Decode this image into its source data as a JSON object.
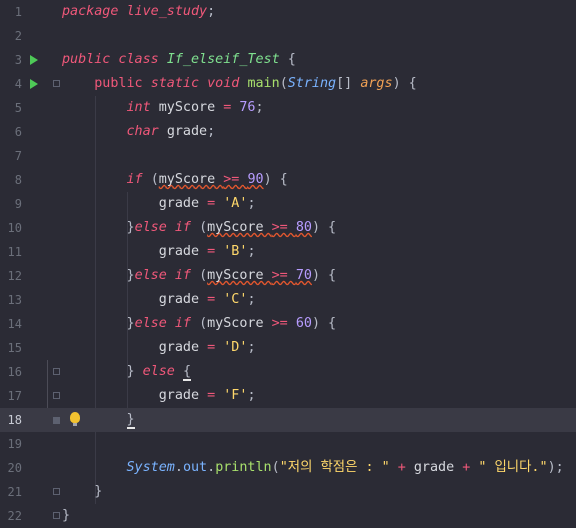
{
  "editor": {
    "current_line": 18,
    "lines": [
      {
        "n": "1",
        "tokens": [
          [
            "kw",
            "package"
          ],
          [
            "var",
            " "
          ],
          [
            "kw",
            "live_study"
          ],
          [
            "punct",
            ";"
          ]
        ]
      },
      {
        "n": "2",
        "tokens": []
      },
      {
        "n": "3",
        "tokens": [
          [
            "kw",
            "public class "
          ],
          [
            "cls",
            "If_elseif_Test"
          ],
          [
            "punct",
            " {"
          ]
        ]
      },
      {
        "n": "4",
        "tokens": [
          [
            "var",
            "    "
          ],
          [
            "kwp",
            "public "
          ],
          [
            "kw",
            "static void "
          ],
          [
            "fn",
            "main"
          ],
          [
            "punct",
            "("
          ],
          [
            "type",
            "String"
          ],
          [
            "punct",
            "[] "
          ],
          [
            "param",
            "args"
          ],
          [
            "punct",
            ") {"
          ]
        ]
      },
      {
        "n": "5",
        "tokens": [
          [
            "var",
            "        "
          ],
          [
            "kw",
            "int "
          ],
          [
            "var",
            "myScore "
          ],
          [
            "op",
            "= "
          ],
          [
            "num",
            "76"
          ],
          [
            "punct",
            ";"
          ]
        ]
      },
      {
        "n": "6",
        "tokens": [
          [
            "var",
            "        "
          ],
          [
            "kw",
            "char "
          ],
          [
            "var",
            "grade"
          ],
          [
            "punct",
            ";"
          ]
        ]
      },
      {
        "n": "7",
        "tokens": []
      },
      {
        "n": "8",
        "tokens": [
          [
            "var",
            "        "
          ],
          [
            "kw",
            "if "
          ],
          [
            "punct",
            "("
          ],
          [
            "var wavy",
            "myScore "
          ],
          [
            "op wavy",
            ">= "
          ],
          [
            "num wavy",
            "90"
          ],
          [
            "punct",
            ") {"
          ]
        ]
      },
      {
        "n": "9",
        "tokens": [
          [
            "var",
            "            grade "
          ],
          [
            "op",
            "= "
          ],
          [
            "str",
            "'A'"
          ],
          [
            "punct",
            ";"
          ]
        ]
      },
      {
        "n": "10",
        "tokens": [
          [
            "var",
            "        "
          ],
          [
            "punct",
            "}"
          ],
          [
            "kw",
            "else if "
          ],
          [
            "punct",
            "("
          ],
          [
            "var wavy",
            "myScore "
          ],
          [
            "op wavy",
            ">= "
          ],
          [
            "num wavy",
            "80"
          ],
          [
            "punct",
            ") {"
          ]
        ]
      },
      {
        "n": "11",
        "tokens": [
          [
            "var",
            "            grade "
          ],
          [
            "op",
            "= "
          ],
          [
            "str",
            "'B'"
          ],
          [
            "punct",
            ";"
          ]
        ]
      },
      {
        "n": "12",
        "tokens": [
          [
            "var",
            "        "
          ],
          [
            "punct",
            "}"
          ],
          [
            "kw",
            "else if "
          ],
          [
            "punct",
            "("
          ],
          [
            "var wavy",
            "myScore "
          ],
          [
            "op wavy",
            ">= "
          ],
          [
            "num wavy",
            "70"
          ],
          [
            "punct",
            ") {"
          ]
        ]
      },
      {
        "n": "13",
        "tokens": [
          [
            "var",
            "            grade "
          ],
          [
            "op",
            "= "
          ],
          [
            "str",
            "'C'"
          ],
          [
            "punct",
            ";"
          ]
        ]
      },
      {
        "n": "14",
        "tokens": [
          [
            "var",
            "        "
          ],
          [
            "punct",
            "}"
          ],
          [
            "kw",
            "else if "
          ],
          [
            "punct",
            "("
          ],
          [
            "var",
            "myScore "
          ],
          [
            "op",
            ">= "
          ],
          [
            "num",
            "60"
          ],
          [
            "punct",
            ") {"
          ]
        ]
      },
      {
        "n": "15",
        "tokens": [
          [
            "var",
            "            grade "
          ],
          [
            "op",
            "= "
          ],
          [
            "str",
            "'D'"
          ],
          [
            "punct",
            ";"
          ]
        ]
      },
      {
        "n": "16",
        "tokens": [
          [
            "var",
            "        "
          ],
          [
            "punct",
            "} "
          ],
          [
            "kw",
            "else "
          ],
          [
            "punct caret",
            "{"
          ]
        ]
      },
      {
        "n": "17",
        "tokens": [
          [
            "var",
            "            grade "
          ],
          [
            "op",
            "= "
          ],
          [
            "str",
            "'F'"
          ],
          [
            "punct",
            ";"
          ]
        ]
      },
      {
        "n": "18",
        "tokens": [
          [
            "var",
            "        "
          ],
          [
            "punct caret",
            "}"
          ]
        ]
      },
      {
        "n": "19",
        "tokens": []
      },
      {
        "n": "20",
        "tokens": [
          [
            "var",
            "        "
          ],
          [
            "type",
            "System"
          ],
          [
            "punct",
            "."
          ],
          [
            "field",
            "out"
          ],
          [
            "punct",
            "."
          ],
          [
            "fn",
            "println"
          ],
          [
            "punct",
            "("
          ],
          [
            "str",
            "\"저의 학점은 : \" "
          ],
          [
            "op",
            "+ "
          ],
          [
            "var",
            "grade "
          ],
          [
            "op",
            "+ "
          ],
          [
            "str",
            "\" 입니다.\""
          ],
          [
            "punct",
            ");"
          ]
        ]
      },
      {
        "n": "21",
        "tokens": [
          [
            "var",
            "    "
          ],
          [
            "punct",
            "}"
          ]
        ]
      },
      {
        "n": "22",
        "tokens": [
          [
            "punct",
            "}"
          ]
        ]
      }
    ],
    "gutter": {
      "run_lines": [
        3,
        4
      ],
      "fold_lines": [
        4,
        16,
        17,
        21,
        22
      ],
      "bulb_line": 18,
      "lock_line": 18
    },
    "colors": {
      "background": "#2b2b35",
      "current_line": "#3a3a45",
      "keyword": "#f0587a",
      "class": "#7fe08f",
      "string": "#ffd86b",
      "number": "#b79cff",
      "type": "#7ab3ff",
      "function": "#a8e06c",
      "parameter": "#f2a255"
    }
  }
}
